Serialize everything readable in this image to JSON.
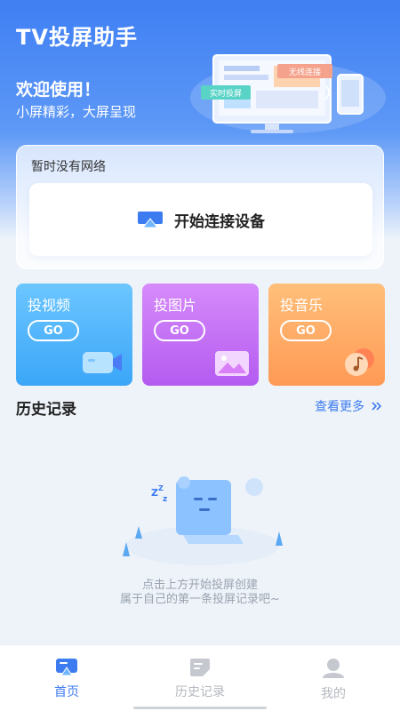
{
  "app": {
    "title": "TV投屏助手"
  },
  "welcome": {
    "title": "欢迎使用！",
    "subtitle": "小屏精彩，大屏呈现",
    "hero_badge_left": "实时投屏",
    "hero_badge_right": "无线连接"
  },
  "connect": {
    "network_status": "暂时没有网络",
    "button_label": "开始连接设备",
    "icon": "screen-cast-icon"
  },
  "tiles": [
    {
      "label": "投视频",
      "go": "GO",
      "icon": "video-camera-icon",
      "color": "#4eb3fb"
    },
    {
      "label": "投图片",
      "go": "GO",
      "icon": "image-icon",
      "color": "#c473f5"
    },
    {
      "label": "投音乐",
      "go": "GO",
      "icon": "music-note-icon",
      "color": "#ffab66"
    }
  ],
  "history": {
    "title": "历史记录",
    "more": "查看更多",
    "more_icon": "double-chevron-right-icon",
    "empty_line1": "点击上方开始投屏创建",
    "empty_line2": "属于自己的第一条投屏记录吧~"
  },
  "tabbar": {
    "items": [
      {
        "label": "首页",
        "icon": "home-cast-icon",
        "active": true
      },
      {
        "label": "历史记录",
        "icon": "history-note-icon",
        "active": false
      },
      {
        "label": "我的",
        "icon": "person-icon",
        "active": false
      }
    ]
  },
  "colors": {
    "brand": "#3f7ff3",
    "accent_link": "#3d7cf0",
    "inactive_tab": "#b4b8bf"
  }
}
